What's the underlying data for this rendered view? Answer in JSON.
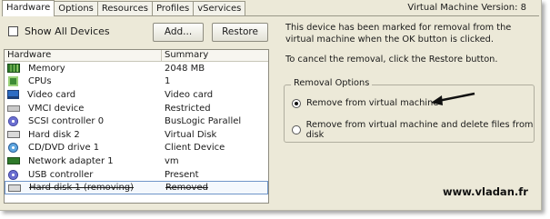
{
  "tabs": [
    "Hardware",
    "Options",
    "Resources",
    "Profiles",
    "vServices"
  ],
  "vm_version": "Virtual Machine Version: 8",
  "show_all_devices": {
    "label": "Show All Devices",
    "checked": false
  },
  "buttons": {
    "add": "Add...",
    "restore": "Restore"
  },
  "table": {
    "headers": {
      "hardware": "Hardware",
      "summary": "Summary"
    },
    "rows": [
      {
        "icon": "memory-icon",
        "name": "Memory",
        "summary": "2048 MB"
      },
      {
        "icon": "cpu-icon",
        "name": "CPUs",
        "summary": "1"
      },
      {
        "icon": "video-card-icon",
        "name": "Video card",
        "summary": "Video card"
      },
      {
        "icon": "vmci-device-icon",
        "name": "VMCI device",
        "summary": "Restricted"
      },
      {
        "icon": "scsi-controller-icon",
        "name": "SCSI controller 0",
        "summary": "BusLogic Parallel"
      },
      {
        "icon": "hard-disk-icon",
        "name": "Hard disk 2",
        "summary": "Virtual Disk"
      },
      {
        "icon": "cd-dvd-icon",
        "name": "CD/DVD drive 1",
        "summary": "Client Device"
      },
      {
        "icon": "network-adapter-icon",
        "name": "Network adapter 1",
        "summary": "vm"
      },
      {
        "icon": "usb-controller-icon",
        "name": "USB controller",
        "summary": "Present"
      },
      {
        "icon": "hard-disk-icon",
        "name": "Hard disk 1 (removing)",
        "summary": "Removed"
      }
    ]
  },
  "message": {
    "line1": "This device has been marked for removal from the virtual machine when the OK button is clicked.",
    "line2": "To cancel the removal, click the Restore button."
  },
  "removal_options": {
    "title": "Removal Options",
    "option1": "Remove from virtual machine",
    "option2": "Remove from virtual machine and delete files from disk",
    "selected": "option1"
  },
  "watermark": "www.vladan.fr"
}
